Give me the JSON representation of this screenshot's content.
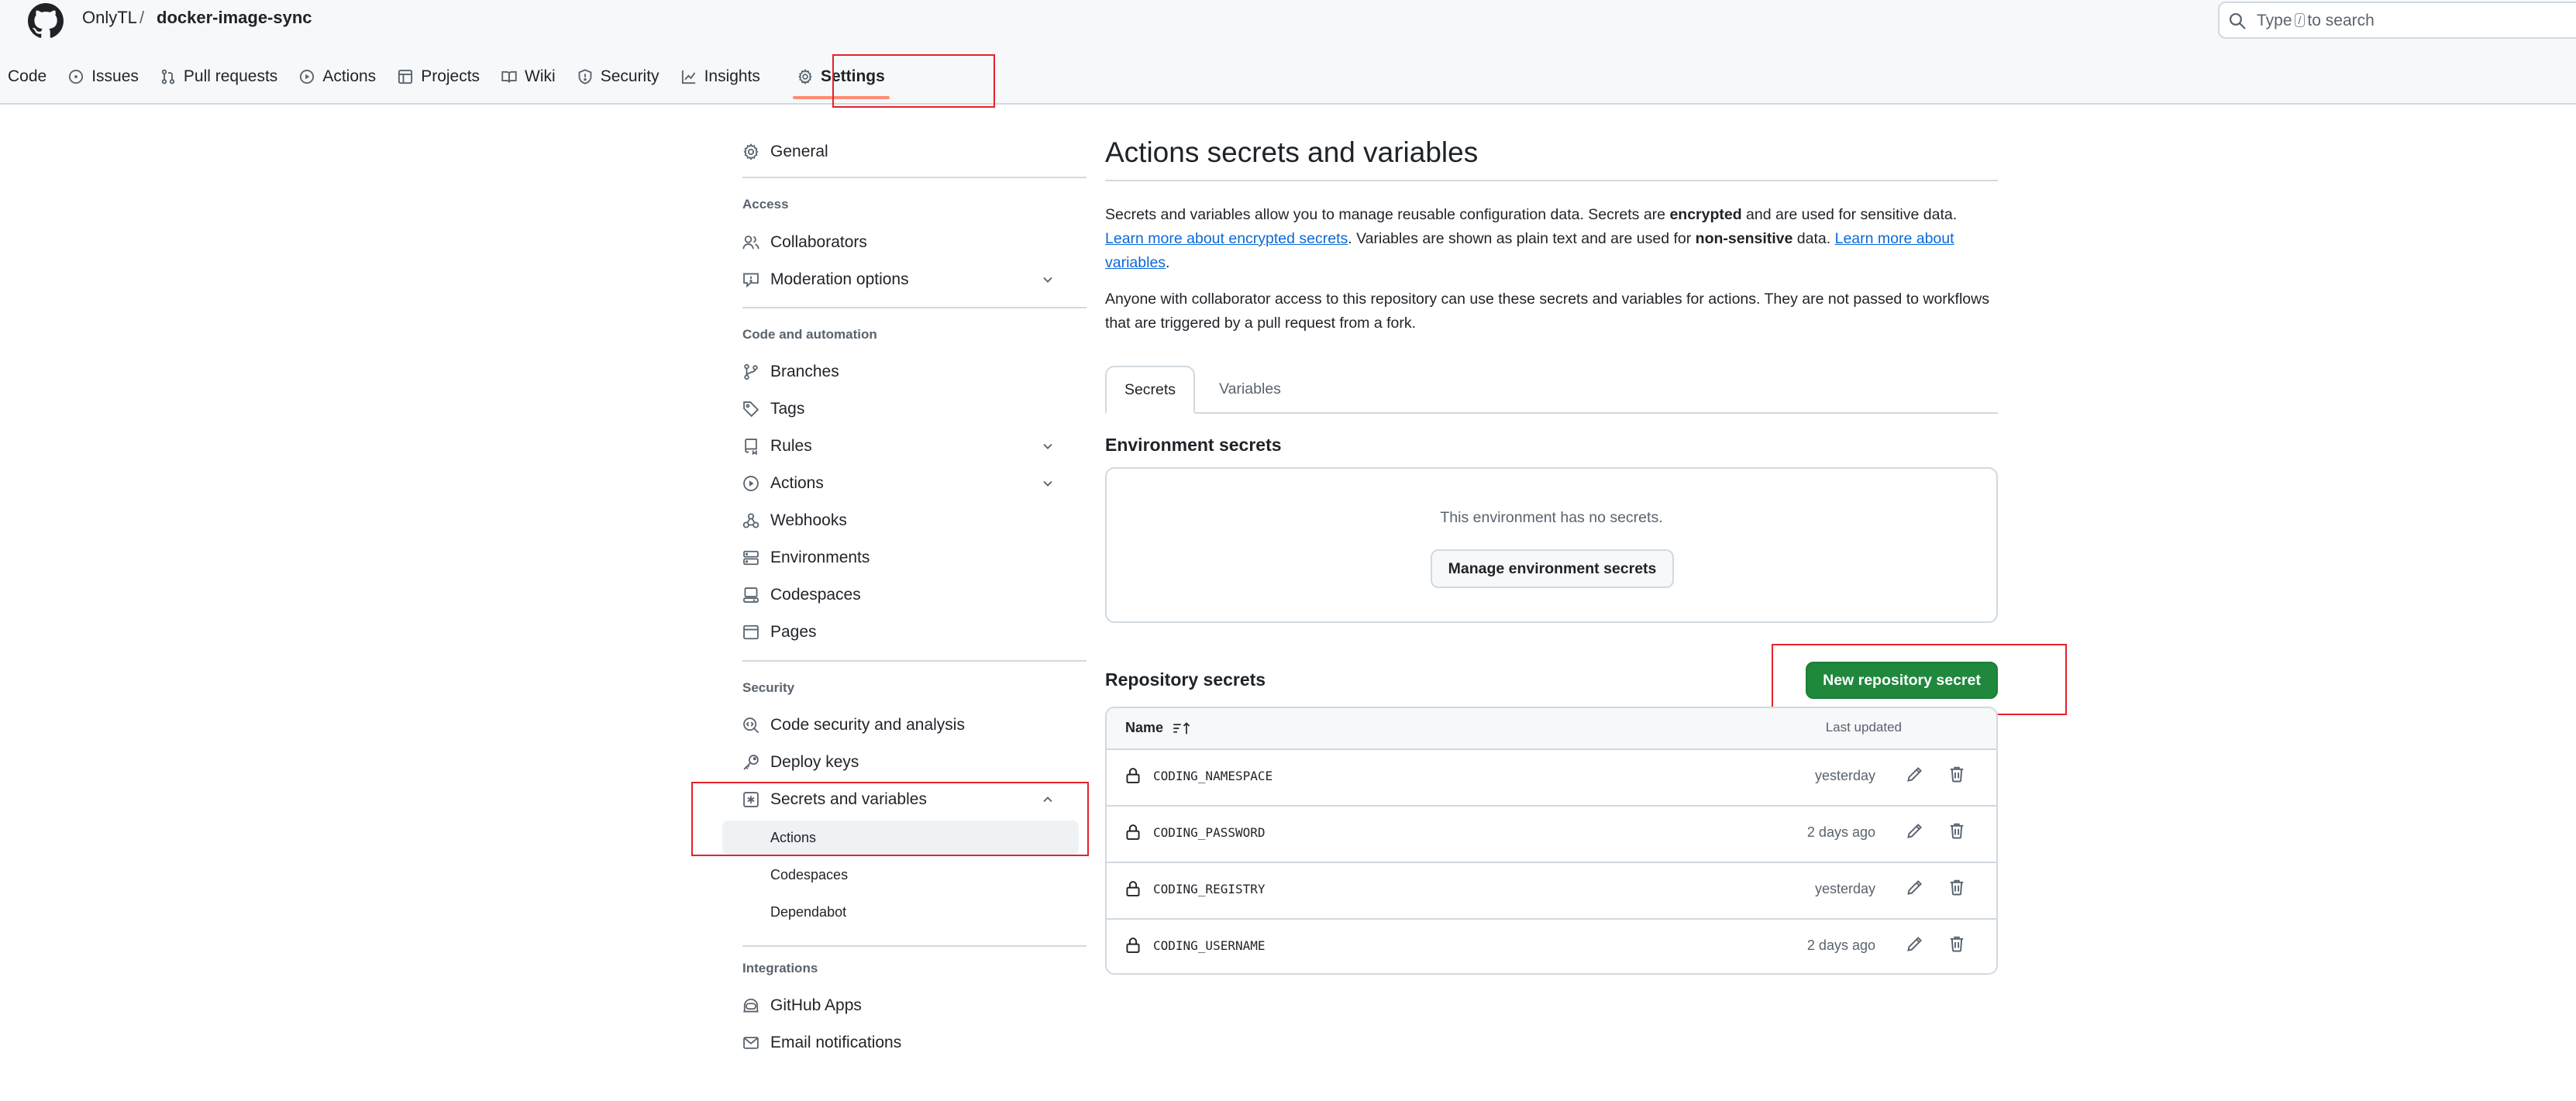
{
  "header": {
    "owner": "OnlyTL",
    "separator": "/",
    "repo": "docker-image-sync",
    "search_prefix": "Type",
    "search_key": "/",
    "search_suffix": "to search"
  },
  "tabs": [
    {
      "label": "Code",
      "icon": "code-icon"
    },
    {
      "label": "Issues",
      "icon": "issue-icon"
    },
    {
      "label": "Pull requests",
      "icon": "pull-request-icon"
    },
    {
      "label": "Actions",
      "icon": "play-icon"
    },
    {
      "label": "Projects",
      "icon": "table-icon"
    },
    {
      "label": "Wiki",
      "icon": "book-icon"
    },
    {
      "label": "Security",
      "icon": "shield-icon"
    },
    {
      "label": "Insights",
      "icon": "graph-icon"
    },
    {
      "label": "Settings",
      "icon": "gear-icon",
      "active": true
    }
  ],
  "sidebar": {
    "general": "General",
    "access_heading": "Access",
    "collaborators": "Collaborators",
    "moderation": "Moderation options",
    "code_heading": "Code and automation",
    "branches": "Branches",
    "tags": "Tags",
    "rules": "Rules",
    "actions": "Actions",
    "webhooks": "Webhooks",
    "environments": "Environments",
    "codespaces": "Codespaces",
    "pages": "Pages",
    "security_heading": "Security",
    "code_security": "Code security and analysis",
    "deploy_keys": "Deploy keys",
    "secrets_variables": "Secrets and variables",
    "sub_actions": "Actions",
    "sub_codespaces": "Codespaces",
    "sub_dependabot": "Dependabot",
    "integrations_heading": "Integrations",
    "github_apps": "GitHub Apps",
    "email_notifications": "Email notifications"
  },
  "main": {
    "title": "Actions secrets and variables",
    "intro": {
      "p1_a": "Secrets and variables allow you to manage reusable configuration data. Secrets are ",
      "p1_b": "encrypted",
      "p1_c": " and are used for sensitive data. ",
      "p1_link1": "Learn more about encrypted secrets",
      "p1_d": ". Variables are shown as plain text and are used for ",
      "p1_e": "non-sensitive",
      "p1_f": " data. ",
      "p1_link2": "Learn more about variables",
      "p1_g": ".",
      "p2": "Anyone with collaborator access to this repository can use these secrets and variables for actions. They are not passed to workflows that are triggered by a pull request from a fork."
    },
    "tab_secrets": "Secrets",
    "tab_variables": "Variables",
    "env_heading": "Environment secrets",
    "env_empty": "This environment has no secrets.",
    "env_button": "Manage environment secrets",
    "repo_heading": "Repository secrets",
    "new_button": "New repository secret",
    "col_name": "Name",
    "col_updated": "Last updated",
    "secrets": [
      {
        "name": "CODING_NAMESPACE",
        "updated": "yesterday"
      },
      {
        "name": "CODING_PASSWORD",
        "updated": "2 days ago"
      },
      {
        "name": "CODING_REGISTRY",
        "updated": "yesterday"
      },
      {
        "name": "CODING_USERNAME",
        "updated": "2 days ago"
      }
    ]
  },
  "colors": {
    "primary": "#1f883d",
    "link": "#0969da",
    "highlight": "#e5222a",
    "tab_underline": "#fd8c73"
  }
}
